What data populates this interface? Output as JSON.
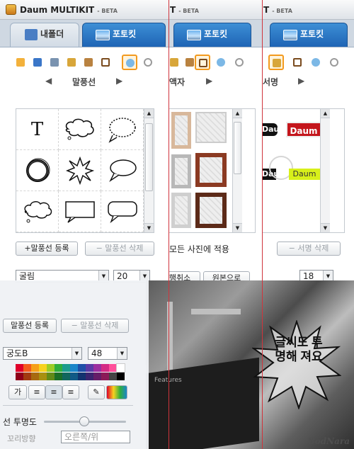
{
  "app": {
    "title": "Daum MULTIKIT",
    "beta": "- BETA",
    "title_partial": "T",
    "beta_partial": "- BETA"
  },
  "tabs": {
    "folder_label": "내폴더",
    "photokit_label": "포토킷"
  },
  "panels": {
    "left": {
      "category": "말풍선",
      "text_tool": "T",
      "add_button": "+말풍선 등록",
      "delete_button": "− 말풍선 삭제",
      "font": "굴림",
      "font_size": "20"
    },
    "middle": {
      "category": "액자",
      "apply_all": "모든 사진에 적용",
      "undo_partial": "실행취소",
      "original": "원본으로"
    },
    "right": {
      "category": "서명",
      "delete_button": "− 서명 삭제",
      "font_size": "18",
      "sig_samples": [
        "Daum",
        "Daum",
        "Daum",
        "Daum"
      ]
    }
  },
  "overlay": {
    "add_button": "말풍선 등록",
    "delete_button": "− 말풍선 삭제",
    "font": "궁도B",
    "font_size": "48",
    "style_label": "가",
    "transparency_label": "선 투명도",
    "direction_label": "꼬리방향",
    "direction_value": "오른쪽/위",
    "burst_text": "글씨도 투명해 져요",
    "photo_text": "Features",
    "watermark": "BodNara"
  },
  "colors": {
    "tab_active": "#1e64b5",
    "red_guide": "#d0343c",
    "selection": "#f39a1e",
    "palette": [
      "#e0002a",
      "#f35b1d",
      "#f6a01a",
      "#f7d21e",
      "#9ccc26",
      "#2fae3c",
      "#1c9c8e",
      "#1b86c9",
      "#1f4fa8",
      "#5a3aa6",
      "#9b2ea0",
      "#d42a85",
      "#ff4f9a",
      "#ffffff",
      "#8f0019",
      "#a23a10",
      "#a86a10",
      "#a89010",
      "#628a18",
      "#1b6e26",
      "#11665d",
      "#115a86",
      "#13336f",
      "#3a2570",
      "#651d68",
      "#8b1a57",
      "#444444",
      "#000000"
    ]
  },
  "icons": [
    "folder-icon",
    "layout-icon",
    "scissors-icon",
    "magic-icon",
    "frame-icon",
    "speech-bubble-icon",
    "stopwatch-icon",
    "arrow-left-icon",
    "arrow-right-icon",
    "home-icon",
    "photo-icon"
  ]
}
